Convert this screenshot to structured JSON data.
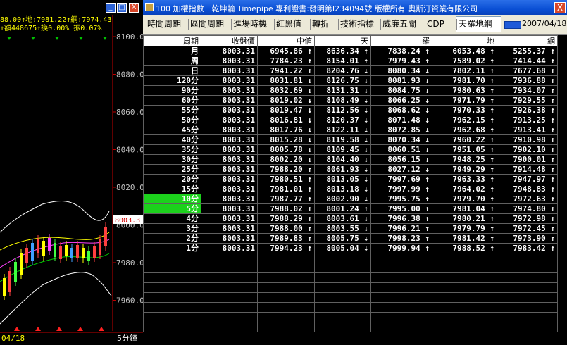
{
  "chart_panel": {
    "header_line1": "88.00↑地:7981.22↑網:7974.43",
    "header_line2": "↑額448675↑換0.00%  振0.07%",
    "price_labels": [
      "8100.0",
      "8080.0",
      "8060.0",
      "8040.0",
      "8020.0",
      "8000.0",
      "7980.0",
      "7960.0"
    ],
    "current_price_tag": "8003.3",
    "date_label": "04/18",
    "interval_label": "5分鐘",
    "window_buttons": {
      "minimize": "_",
      "restore": "□",
      "close": "X"
    }
  },
  "window": {
    "title": "100 加權指數　乾坤輪 Timepipe 專利證書:發明第I234094號 版權所有 奧斯汀資業有限公司",
    "close_label": "X"
  },
  "toolbar": {
    "tabs": [
      "時間周期",
      "區間周期",
      "進場時機",
      "紅黑值",
      "轉折",
      "技術指標",
      "威廉五關",
      "CDP",
      "天羅地網"
    ],
    "active_tab": "天羅地網",
    "date": "2007/04/18"
  },
  "table": {
    "headers": [
      "周期",
      "收盤價",
      "中値",
      "天",
      "羅",
      "地",
      "網"
    ],
    "rows": [
      {
        "period": "月",
        "close": "8003.31",
        "mid": "6945.86 ↑",
        "tian": "8636.34 ↑",
        "luo": "7838.24 ↑",
        "di": "6053.48 ↑",
        "wang": "5255.37 ↑",
        "hl": false
      },
      {
        "period": "周",
        "close": "8003.31",
        "mid": "7784.23 ↑",
        "tian": "8154.01 ↑",
        "luo": "7979.43 ↑",
        "di": "7589.02 ↑",
        "wang": "7414.44 ↑",
        "hl": false
      },
      {
        "period": "日",
        "close": "8003.31",
        "mid": "7941.22 ↑",
        "tian": "8204.76 ↓",
        "luo": "8080.34 ↓",
        "di": "7802.11 ↑",
        "wang": "7677.68 ↑",
        "hl": false
      },
      {
        "period": "120分",
        "close": "8003.31",
        "mid": "8031.81 ↓",
        "tian": "8126.75 ↓",
        "luo": "8081.93 ↓",
        "di": "7981.70 ↑",
        "wang": "7936.88 ↑",
        "hl": false
      },
      {
        "period": "90分",
        "close": "8003.31",
        "mid": "8032.69 ↓",
        "tian": "8131.31 ↓",
        "luo": "8084.75 ↓",
        "di": "7980.63 ↑",
        "wang": "7934.07 ↑",
        "hl": false
      },
      {
        "period": "60分",
        "close": "8003.31",
        "mid": "8019.02 ↓",
        "tian": "8108.49 ↓",
        "luo": "8066.25 ↓",
        "di": "7971.79 ↑",
        "wang": "7929.55 ↑",
        "hl": false
      },
      {
        "period": "55分",
        "close": "8003.31",
        "mid": "8019.47 ↓",
        "tian": "8112.56 ↓",
        "luo": "8068.62 ↓",
        "di": "7970.33 ↑",
        "wang": "7926.38 ↑",
        "hl": false
      },
      {
        "period": "50分",
        "close": "8003.31",
        "mid": "8016.81 ↓",
        "tian": "8120.37 ↓",
        "luo": "8071.48 ↓",
        "di": "7962.15 ↑",
        "wang": "7913.25 ↑",
        "hl": false
      },
      {
        "period": "45分",
        "close": "8003.31",
        "mid": "8017.76 ↓",
        "tian": "8122.11 ↓",
        "luo": "8072.85 ↓",
        "di": "7962.68 ↑",
        "wang": "7913.41 ↑",
        "hl": false
      },
      {
        "period": "40分",
        "close": "8003.31",
        "mid": "8015.28 ↓",
        "tian": "8119.58 ↓",
        "luo": "8070.34 ↓",
        "di": "7960.22 ↑",
        "wang": "7910.98 ↑",
        "hl": false
      },
      {
        "period": "35分",
        "close": "8003.31",
        "mid": "8005.78 ↓",
        "tian": "8109.45 ↓",
        "luo": "8060.51 ↓",
        "di": "7951.05 ↑",
        "wang": "7902.10 ↑",
        "hl": false
      },
      {
        "period": "30分",
        "close": "8003.31",
        "mid": "8002.20 ↓",
        "tian": "8104.40 ↓",
        "luo": "8056.15 ↓",
        "di": "7948.25 ↑",
        "wang": "7900.01 ↑",
        "hl": false
      },
      {
        "period": "25分",
        "close": "8003.31",
        "mid": "7988.20 ↑",
        "tian": "8061.93 ↓",
        "luo": "8027.12 ↓",
        "di": "7949.29 ↑",
        "wang": "7914.48 ↑",
        "hl": false
      },
      {
        "period": "20分",
        "close": "8003.31",
        "mid": "7980.51 ↑",
        "tian": "8013.05 ↓",
        "luo": "7997.69 ↑",
        "di": "7963.33 ↑",
        "wang": "7947.97 ↑",
        "hl": false
      },
      {
        "period": "15分",
        "close": "8003.31",
        "mid": "7981.01 ↑",
        "tian": "8013.18 ↓",
        "luo": "7997.99 ↑",
        "di": "7964.02 ↑",
        "wang": "7948.83 ↑",
        "hl": false
      },
      {
        "period": "10分",
        "close": "8003.31",
        "mid": "7987.77 ↑",
        "tian": "8002.90 ↓",
        "luo": "7995.75 ↑",
        "di": "7979.70 ↑",
        "wang": "7972.63 ↑",
        "hl": true
      },
      {
        "period": "5分",
        "close": "8003.31",
        "mid": "7988.02 ↑",
        "tian": "8001.24 ↑",
        "luo": "7995.00 ↑",
        "di": "7981.04 ↑",
        "wang": "7974.80 ↑",
        "hl": true
      },
      {
        "period": "4分",
        "close": "8003.31",
        "mid": "7988.29 ↑",
        "tian": "8003.61 ↓",
        "luo": "7996.38 ↑",
        "di": "7980.21 ↑",
        "wang": "7972.98 ↑",
        "hl": false
      },
      {
        "period": "3分",
        "close": "8003.31",
        "mid": "7988.00 ↑",
        "tian": "8003.55 ↓",
        "luo": "7996.21 ↑",
        "di": "7979.79 ↑",
        "wang": "7972.45 ↑",
        "hl": false
      },
      {
        "period": "2分",
        "close": "8003.31",
        "mid": "7989.83 ↑",
        "tian": "8005.75 ↓",
        "luo": "7998.23 ↑",
        "di": "7981.42 ↑",
        "wang": "7973.90 ↑",
        "hl": false
      },
      {
        "period": "1分",
        "close": "8003.31",
        "mid": "7994.23 ↑",
        "tian": "8005.04 ↓",
        "luo": "7999.94 ↑",
        "di": "7988.52 ↑",
        "wang": "7983.42 ↑",
        "hl": false
      }
    ],
    "blank_row_count": 8
  }
}
